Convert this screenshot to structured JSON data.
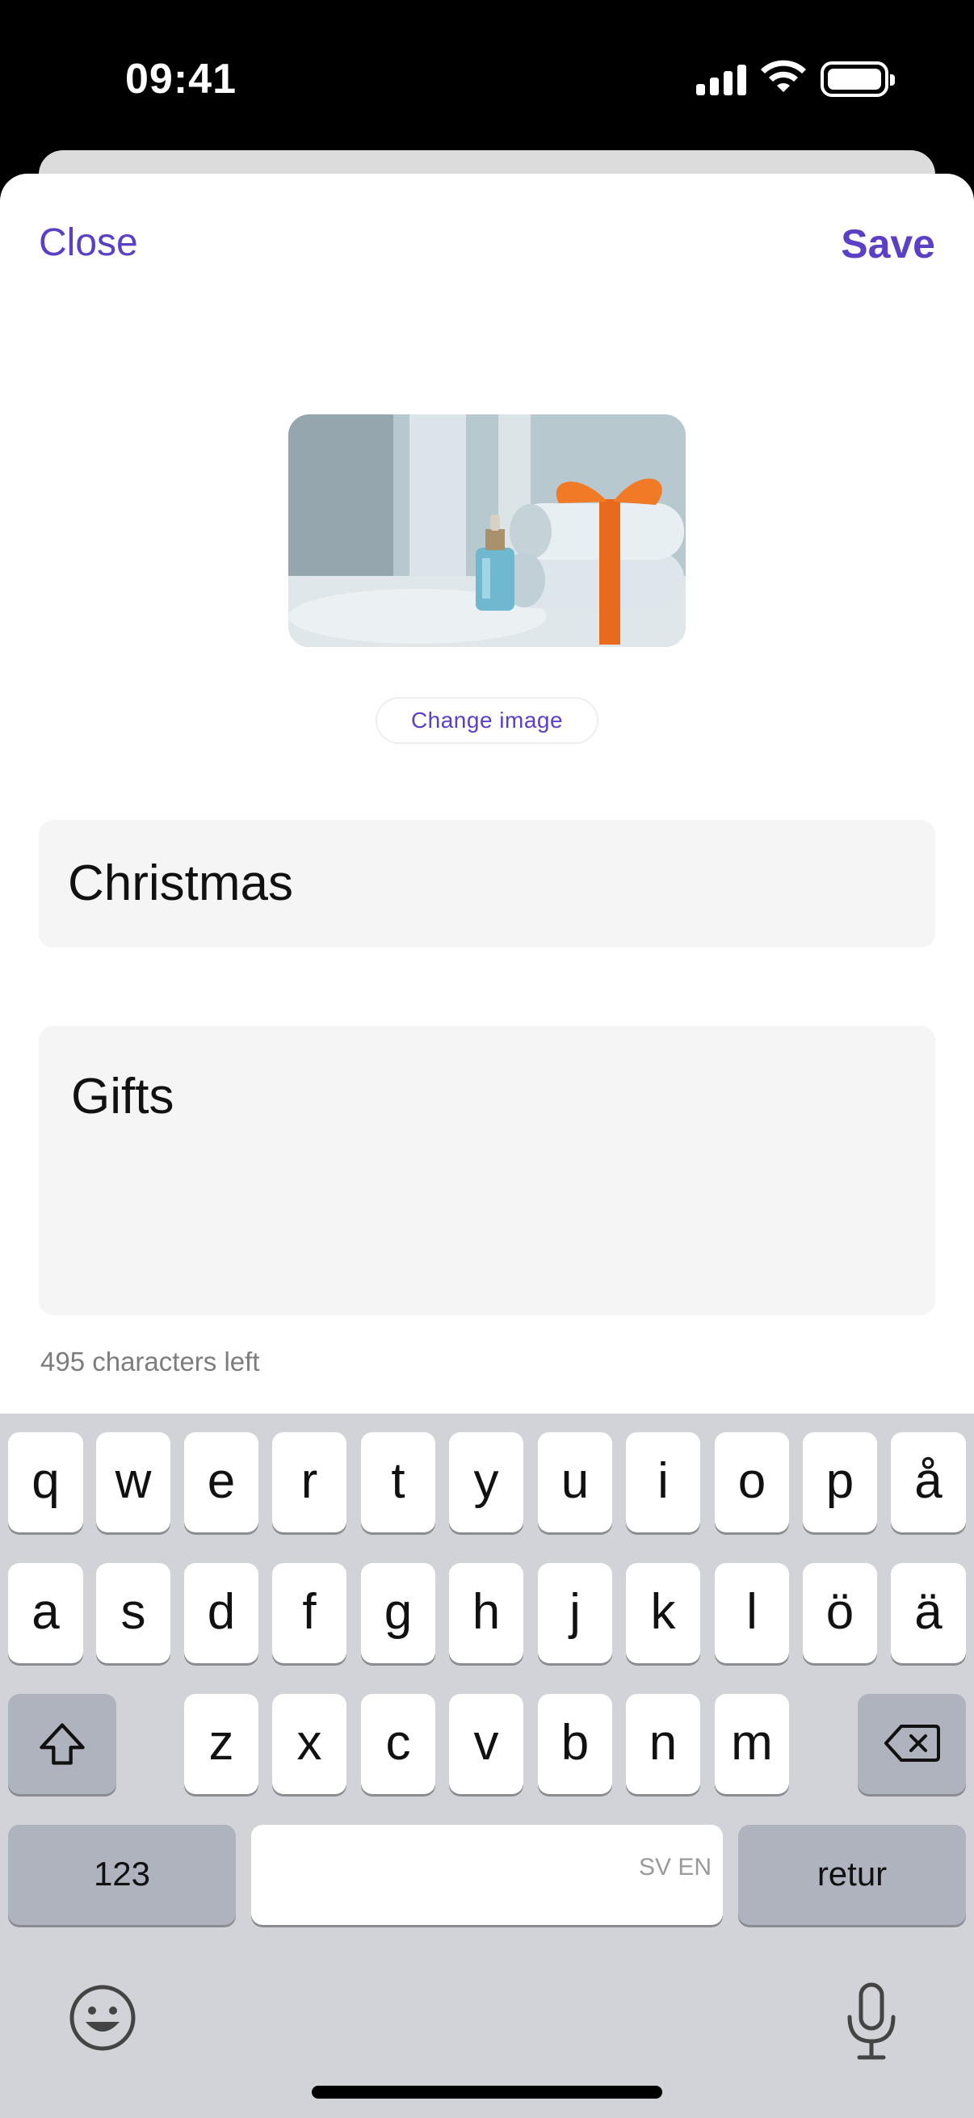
{
  "status_bar": {
    "time": "09:41"
  },
  "sheet": {
    "close_label": "Close",
    "save_label": "Save",
    "change_image_label": "Change image",
    "title_value": "Christmas",
    "description_value": "Gifts",
    "chars_left": "495 characters left"
  },
  "keyboard": {
    "row1": [
      "q",
      "w",
      "e",
      "r",
      "t",
      "y",
      "u",
      "i",
      "o",
      "p",
      "å"
    ],
    "row2": [
      "a",
      "s",
      "d",
      "f",
      "g",
      "h",
      "j",
      "k",
      "l",
      "ö",
      "ä"
    ],
    "row3": [
      "z",
      "x",
      "c",
      "v",
      "b",
      "n",
      "m"
    ],
    "numbers_label": "123",
    "return_label": "retur",
    "space_language": "SV EN"
  },
  "icons": {
    "shift": "shift-icon",
    "delete": "delete-icon",
    "emoji": "emoji-icon",
    "mic": "microphone-icon"
  },
  "colors": {
    "accent": "#5b3fc4"
  }
}
